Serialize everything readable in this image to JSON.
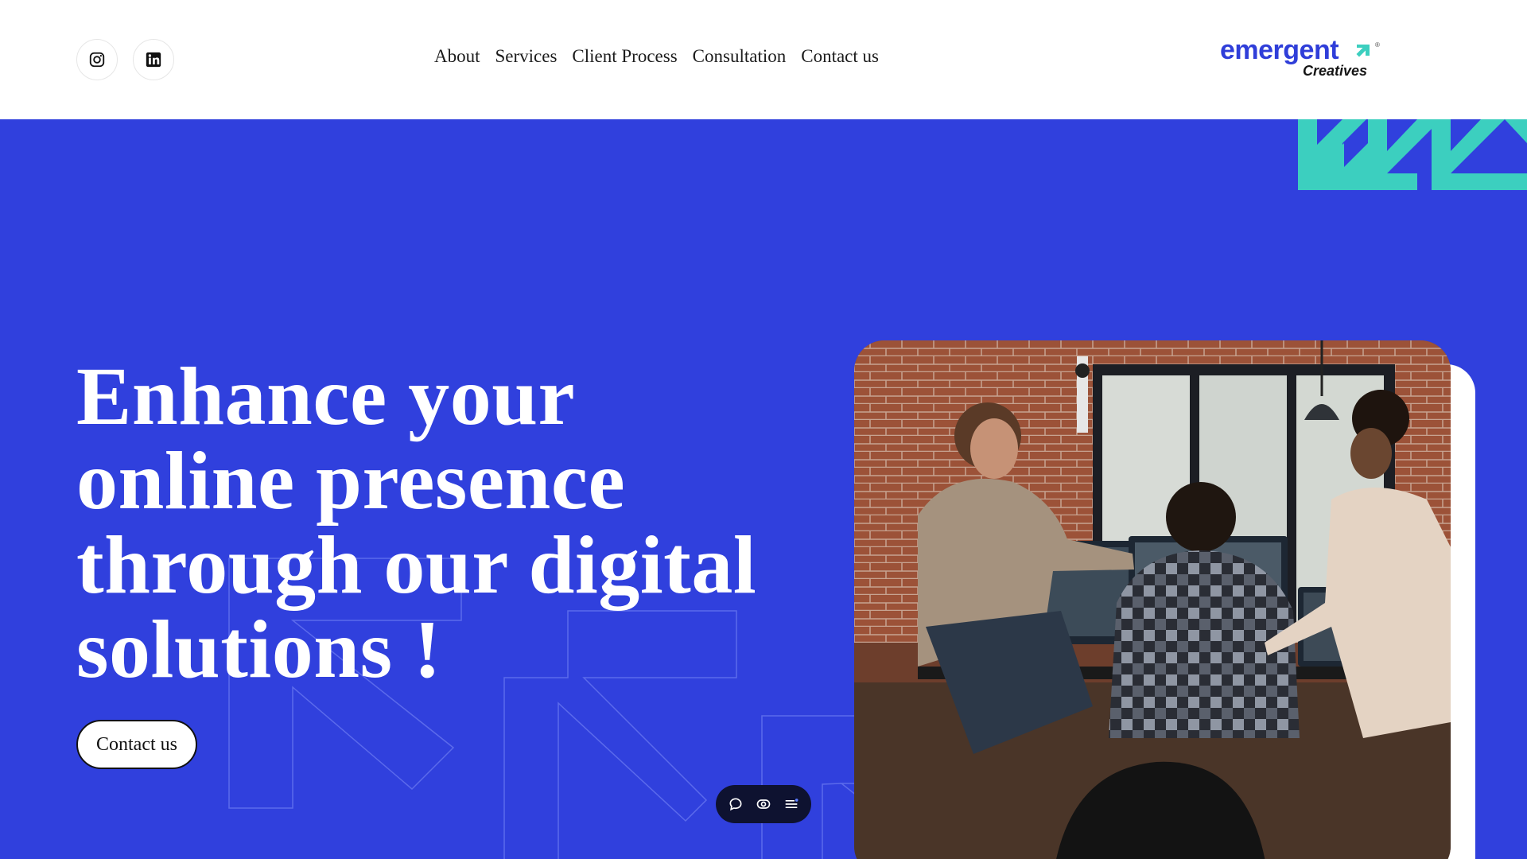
{
  "header": {
    "social": [
      {
        "name": "instagram-icon",
        "label": "Instagram"
      },
      {
        "name": "linkedin-icon",
        "label": "LinkedIn"
      }
    ],
    "nav": [
      {
        "label": "About"
      },
      {
        "label": "Services"
      },
      {
        "label": "Client Process"
      },
      {
        "label": "Consultation"
      },
      {
        "label": "Contact us"
      }
    ],
    "logo": {
      "word": "emergent",
      "sub": "Creatives",
      "mark": "®",
      "arrow_color": "#3ccfbf",
      "word_color": "#2f3ed9"
    }
  },
  "hero": {
    "title_lines": [
      "Enhance your",
      "online presence",
      "through our digital",
      "solutions !"
    ],
    "cta_label": "Contact us",
    "background_color": "#3040dd",
    "accent_color": "#3ccfbf",
    "image_description_icon": "team-at-computers-photo"
  },
  "toolbar": {
    "items": [
      {
        "icon": "chat-bubble-icon"
      },
      {
        "icon": "eye-icon"
      },
      {
        "icon": "menu-icon"
      }
    ]
  }
}
